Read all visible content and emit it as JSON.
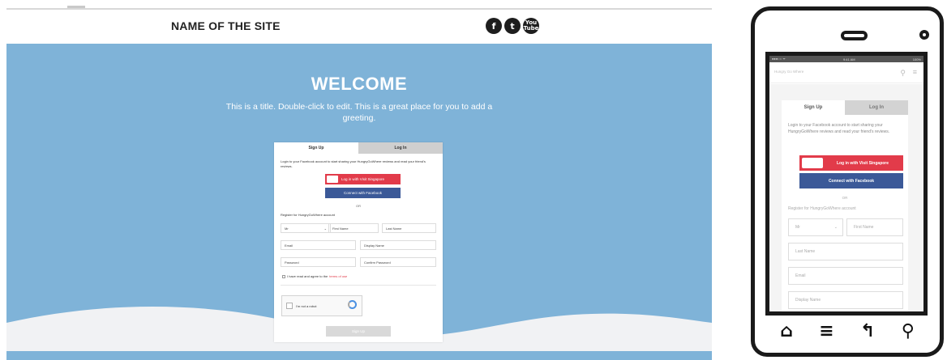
{
  "desktop": {
    "header": {
      "site_name": "NAME OF THE SITE",
      "social_icons": [
        "facebook-icon",
        "twitter-icon",
        "youtube-icon"
      ],
      "social_glyphs": [
        "f",
        "t",
        "You\nTube"
      ]
    },
    "hero": {
      "title": "WELCOME",
      "subtitle": "This is a title. Double-click to edit. This is a great place for you to add a greeting.",
      "background_color": "#7fb3d8"
    },
    "form": {
      "tabs": [
        {
          "label": "Sign Up",
          "active": true
        },
        {
          "label": "Log In",
          "active": false
        }
      ],
      "intro": "Login to your Facebook account to start sharing your HungryGoWhere reviews and read your friend's reviews.",
      "visit_singapore_button": "Log in with Visit Singapore",
      "facebook_button": "Connect with Facebook",
      "or_label": "OR",
      "register_label": "Register for HungryGoWhere account",
      "fields": {
        "title_select": "Mr",
        "first_name": "First Name",
        "last_name": "Last Name",
        "email": "Email",
        "display_name": "Display Name",
        "password": "Password",
        "confirm_password": "Confirm Password"
      },
      "agree_prefix": "I have read and agree to the",
      "agree_link": "terms of use",
      "recaptcha_label": "I'm not a robot",
      "submit_label": "Sign Up"
    }
  },
  "mobile": {
    "status": {
      "left": "●●●○○ ᯤ",
      "center": "9:41 AM",
      "right": "100%"
    },
    "header_title": "Hungry Go Where",
    "form": {
      "tabs": [
        {
          "label": "Sign Up",
          "active": true
        },
        {
          "label": "Log In",
          "active": false
        }
      ],
      "intro": "Login to your Facebook account to start sharing your HungryGoWhere reviews and read your friend's reviews.",
      "visit_singapore_button": "Log in with Visit Singapore",
      "facebook_button": "Connect with Facebook",
      "or_label": "OR",
      "register_label": "Register for HungryGoWhere account",
      "fields": {
        "title_select": "Mr",
        "first_name": "First Name",
        "last_name": "Last Name",
        "email": "Email",
        "display_name": "Display Name"
      }
    },
    "nav_icons": [
      "home-icon",
      "menu-icon",
      "back-icon",
      "search-icon"
    ],
    "nav_glyphs": [
      "⌂",
      "≡",
      "↰",
      "⚲"
    ]
  }
}
